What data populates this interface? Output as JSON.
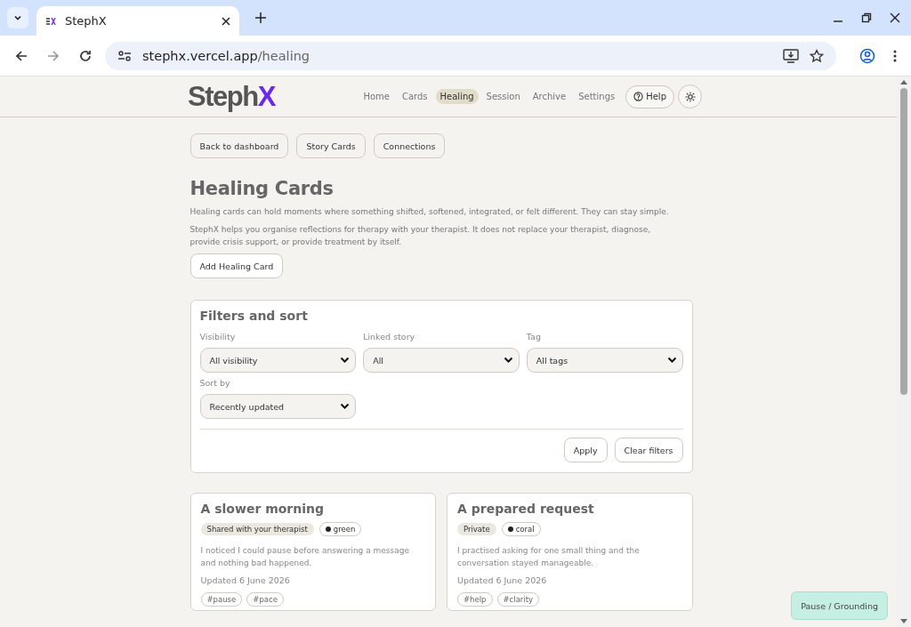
{
  "browser": {
    "tab_title": "StephX",
    "url_host": "stephx.vercel.app",
    "url_path": "/healing"
  },
  "nav": {
    "logo_main": "Steph",
    "logo_accent": "X",
    "items": [
      {
        "label": "Home",
        "selected": false
      },
      {
        "label": "Cards",
        "selected": false
      },
      {
        "label": "Healing",
        "selected": true
      },
      {
        "label": "Session",
        "selected": false
      },
      {
        "label": "Archive",
        "selected": false
      },
      {
        "label": "Settings",
        "selected": false
      }
    ],
    "help": "Help"
  },
  "top_buttons": [
    "Back to dashboard",
    "Story Cards",
    "Connections"
  ],
  "title": "Healing Cards",
  "paragraphs": [
    "Healing cards can hold moments where something shifted, softened, integrated, or felt different. They can stay simple.",
    "StephX helps you organise reflections for therapy with your therapist. It does not replace your therapist, diagnose, provide crisis support, or provide treatment by itself."
  ],
  "add_button": "Add Healing Card",
  "filters": {
    "title": "Filters and sort",
    "fields": [
      {
        "label": "Visibility",
        "value": "All visibility"
      },
      {
        "label": "Linked story",
        "value": "All"
      },
      {
        "label": "Tag",
        "value": "All tags"
      },
      {
        "label": "Sort by",
        "value": "Recently updated"
      }
    ],
    "buttons": [
      "Apply",
      "Clear filters"
    ]
  },
  "cards": [
    {
      "title": "A slower morning",
      "visibility": "Shared with your therapist",
      "colour": "green",
      "text": "I noticed I could pause before answering a message and nothing bad happened.",
      "updated": "Updated 6 June 2026",
      "tags": [
        "#pause",
        "#pace"
      ]
    },
    {
      "title": "A prepared request",
      "visibility": "Private",
      "colour": "coral",
      "text": "I practised asking for one small thing and the conversation stayed manageable.",
      "updated": "Updated 6 June 2026",
      "tags": [
        "#help",
        "#clarity"
      ]
    }
  ],
  "grounding_button": "Pause / Grounding"
}
